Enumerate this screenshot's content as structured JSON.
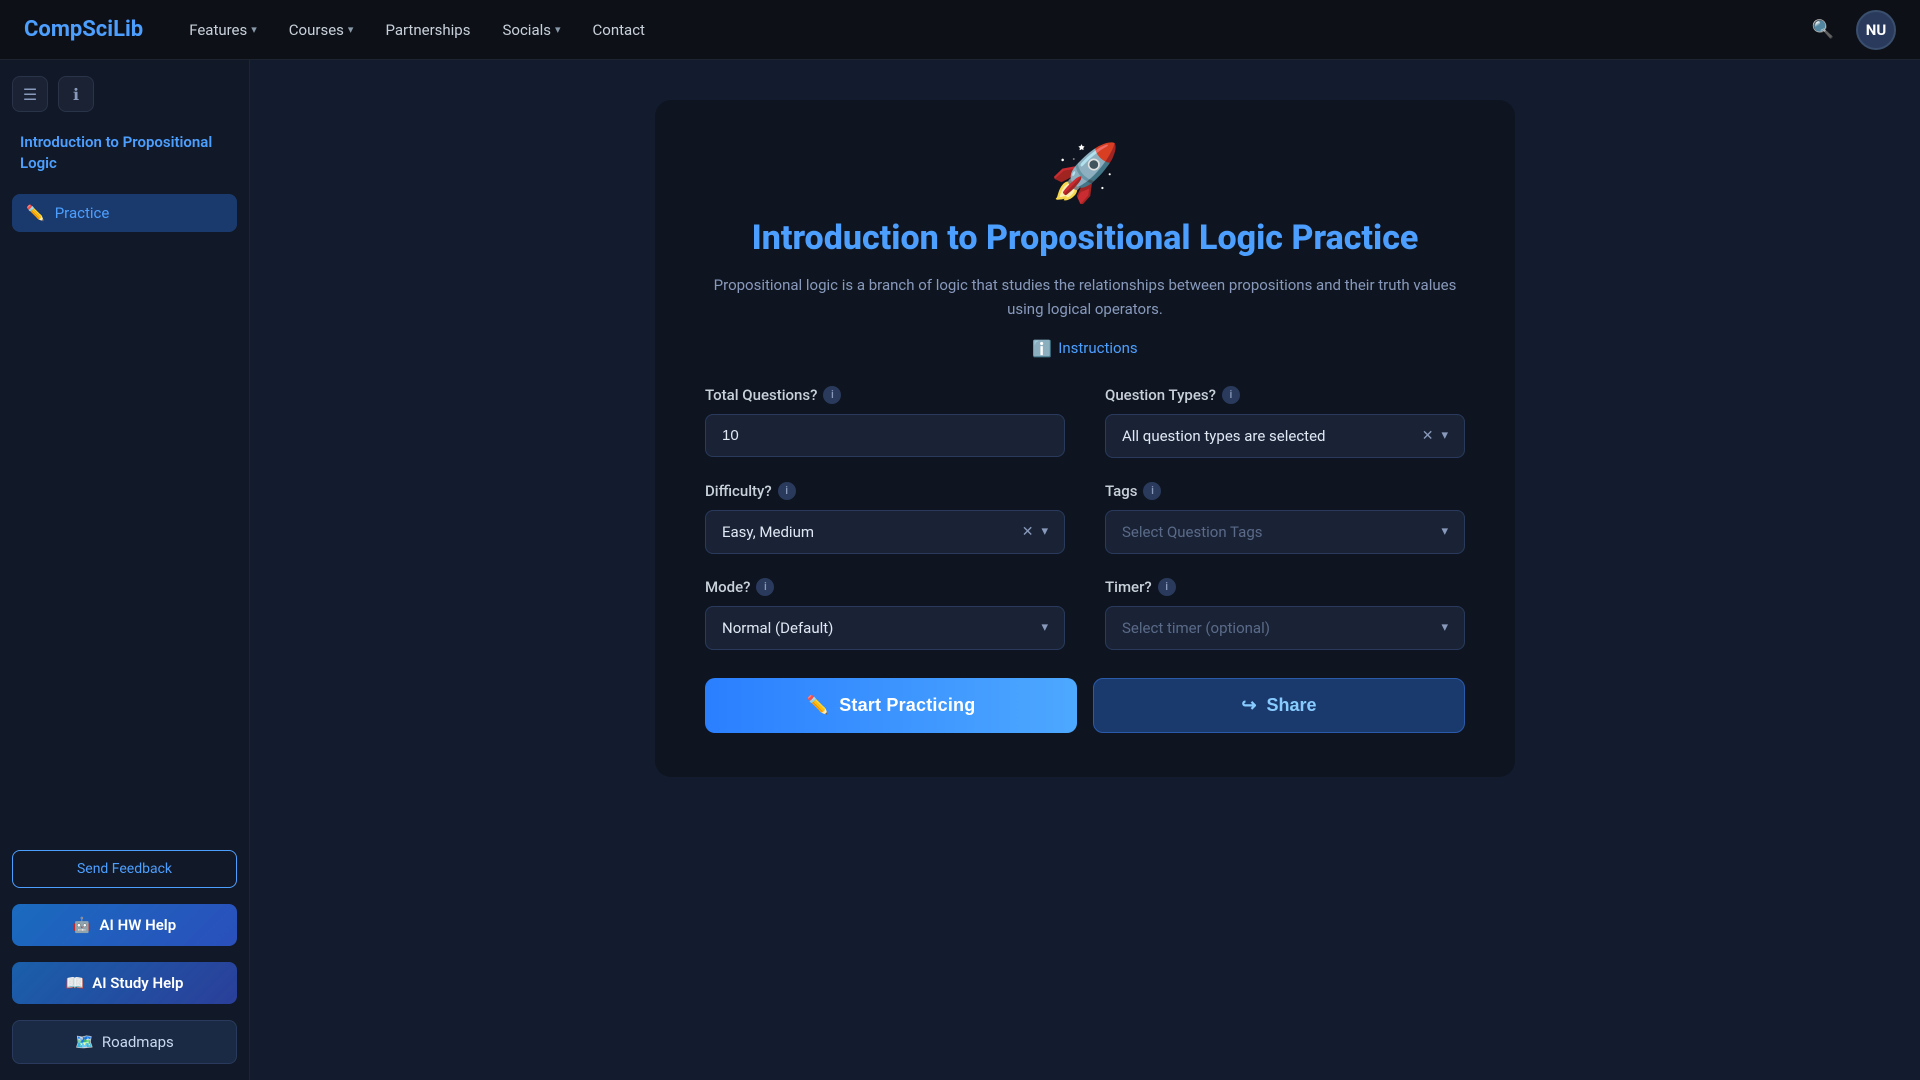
{
  "topnav": {
    "logo_prefix": "CompSci",
    "logo_suffix": "Lib",
    "items": [
      {
        "label": "Features",
        "has_chevron": true
      },
      {
        "label": "Courses",
        "has_chevron": true
      },
      {
        "label": "Partnerships",
        "has_chevron": false
      },
      {
        "label": "Socials",
        "has_chevron": true
      },
      {
        "label": "Contact",
        "has_chevron": false
      }
    ],
    "avatar_initials": "NU"
  },
  "sidebar": {
    "course_title": "Introduction to\nPropositional Logic",
    "nav_items": [
      {
        "id": "practice",
        "label": "Practice",
        "active": true
      }
    ],
    "feedback_label": "Send Feedback",
    "ai_hw_label": "AI HW Help",
    "ai_study_label": "AI Study Help",
    "roadmaps_label": "Roadmaps"
  },
  "main": {
    "rocket_emoji": "🚀",
    "page_title": "Introduction to Propositional Logic Practice",
    "page_desc": "Propositional logic is a branch of logic that studies the relationships between propositions and\ntheir truth values using logical operators.",
    "instructions_label": "Instructions",
    "form": {
      "total_questions_label": "Total Questions?",
      "total_questions_value": "10",
      "question_types_label": "Question Types?",
      "question_types_value": "All question types are selected",
      "difficulty_label": "Difficulty?",
      "difficulty_value": "Easy, Medium",
      "tags_label": "Tags",
      "tags_placeholder": "Select Question Tags",
      "mode_label": "Mode?",
      "mode_value": "Normal (Default)",
      "timer_label": "Timer?",
      "timer_placeholder": "Select timer (optional)"
    },
    "start_button": "Start Practicing",
    "share_button": "Share"
  }
}
